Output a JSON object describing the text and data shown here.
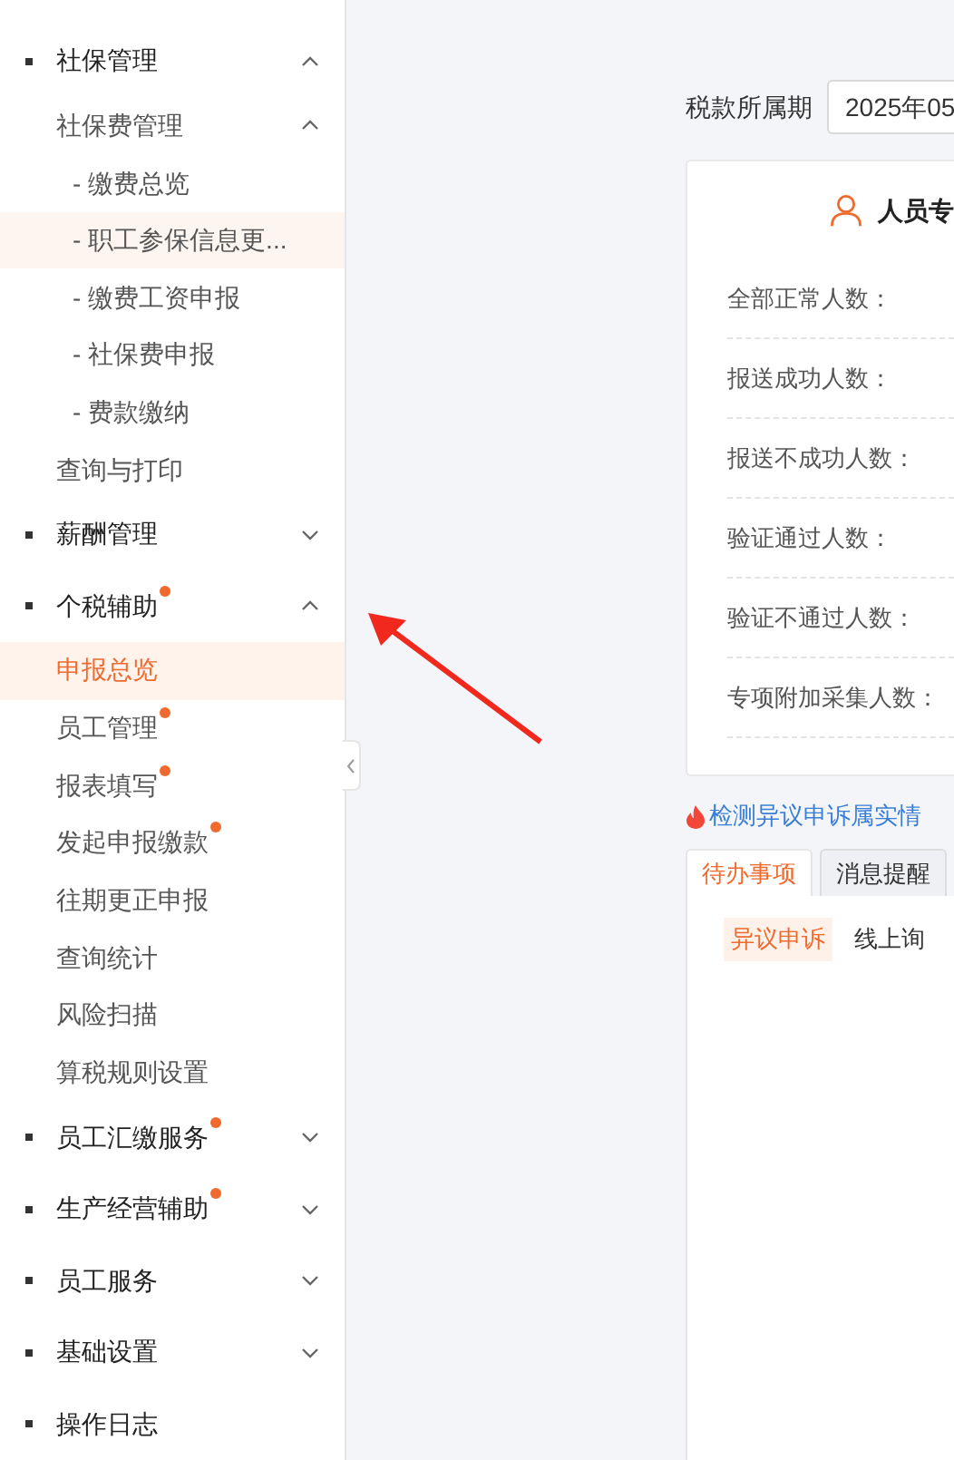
{
  "sidebar": {
    "items": [
      {
        "label": "社保管理",
        "dot": false,
        "expanded": true,
        "selected": false,
        "hovered": false,
        "children": [
          {
            "label": "社保费管理",
            "dot": false,
            "expanded": true,
            "selected": false,
            "hovered": false,
            "children": [
              {
                "label": "- 缴费总览",
                "dot": false,
                "selected": false,
                "hovered": false
              },
              {
                "label": "- 职工参保信息更...",
                "dot": false,
                "selected": false,
                "hovered": true
              },
              {
                "label": "- 缴费工资申报",
                "dot": false,
                "selected": false,
                "hovered": false
              },
              {
                "label": "- 社保费申报",
                "dot": false,
                "selected": false,
                "hovered": false
              },
              {
                "label": "- 费款缴纳",
                "dot": false,
                "selected": false,
                "hovered": false
              }
            ]
          },
          {
            "label": "查询与打印",
            "dot": false,
            "selected": false,
            "hovered": false
          }
        ]
      },
      {
        "label": "薪酬管理",
        "dot": false,
        "expanded": false,
        "selected": false,
        "hovered": false
      },
      {
        "label": "个税辅助",
        "dot": true,
        "expanded": true,
        "selected": false,
        "hovered": false,
        "children": [
          {
            "label": "申报总览",
            "dot": false,
            "selected": true,
            "hovered": false
          },
          {
            "label": "员工管理",
            "dot": true,
            "selected": false,
            "hovered": false
          },
          {
            "label": "报表填写",
            "dot": true,
            "selected": false,
            "hovered": false
          },
          {
            "label": "发起申报缴款",
            "dot": true,
            "selected": false,
            "hovered": false
          },
          {
            "label": "往期更正申报",
            "dot": false,
            "selected": false,
            "hovered": false
          },
          {
            "label": "查询统计",
            "dot": false,
            "selected": false,
            "hovered": false
          },
          {
            "label": "风险扫描",
            "dot": false,
            "selected": false,
            "hovered": false
          },
          {
            "label": "算税规则设置",
            "dot": false,
            "selected": false,
            "hovered": false
          }
        ]
      },
      {
        "label": "员工汇缴服务",
        "dot": true,
        "expanded": false,
        "selected": false,
        "hovered": false
      },
      {
        "label": "生产经营辅助",
        "dot": true,
        "expanded": false,
        "selected": false,
        "hovered": false
      },
      {
        "label": "员工服务",
        "dot": false,
        "expanded": false,
        "selected": false,
        "hovered": false
      },
      {
        "label": "基础设置",
        "dot": false,
        "expanded": false,
        "selected": false,
        "hovered": false
      },
      {
        "label": "操作日志",
        "dot": false,
        "selected": false,
        "hovered": false
      }
    ]
  },
  "period": {
    "label": "税款所属期",
    "value": "2025年05"
  },
  "card": {
    "title": "人员专",
    "rows": [
      {
        "label": "全部正常人数："
      },
      {
        "label": "报送成功人数："
      },
      {
        "label": "报送不成功人数："
      },
      {
        "label": "验证通过人数："
      },
      {
        "label": "验证不通过人数："
      },
      {
        "label": "专项附加采集人数："
      }
    ]
  },
  "notice": "检测异议申诉属实情",
  "tabs": [
    {
      "label": "待办事项",
      "selected": true
    },
    {
      "label": "消息提醒",
      "selected": false
    }
  ],
  "todo": {
    "tag": "异议申诉",
    "text": "线上询"
  }
}
